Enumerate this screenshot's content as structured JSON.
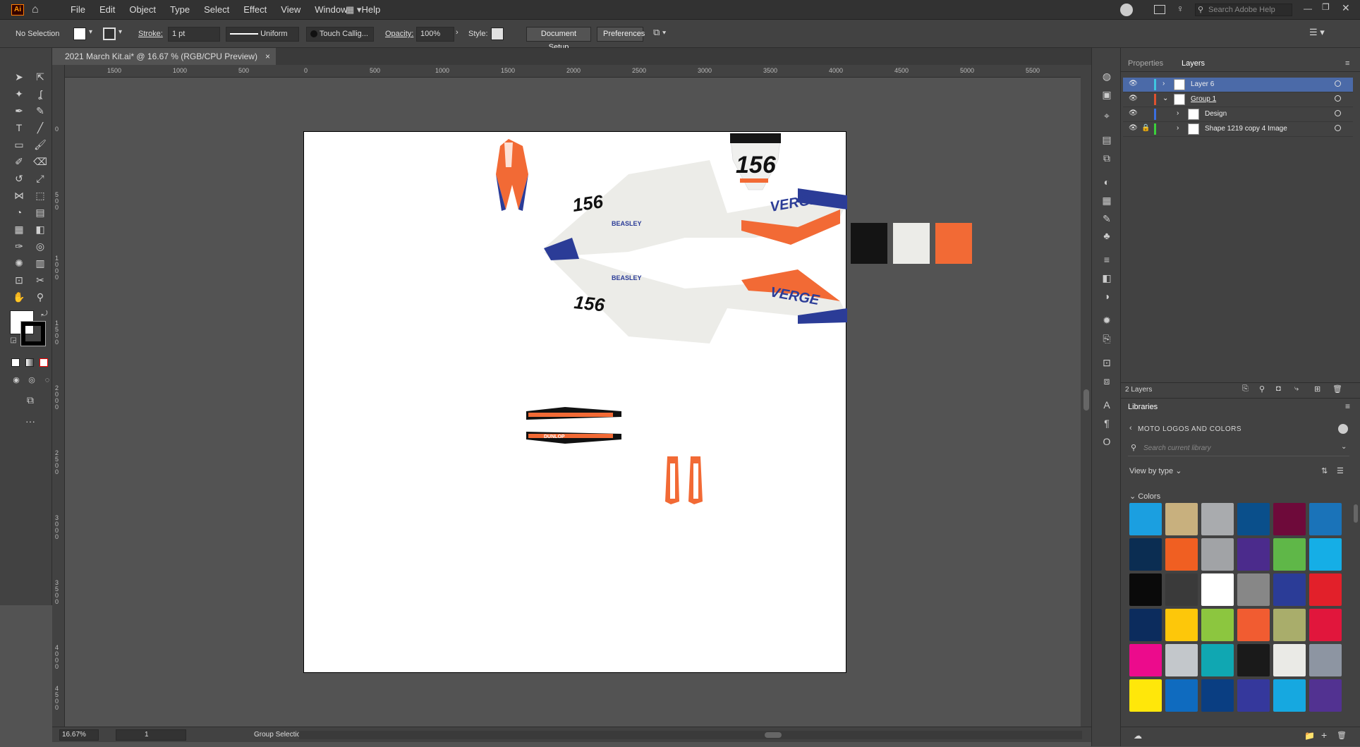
{
  "app": {
    "logo": "Ai",
    "menus": [
      "File",
      "Edit",
      "Object",
      "Type",
      "Select",
      "Effect",
      "View",
      "Window",
      "Help"
    ],
    "search_placeholder": "Search Adobe Help"
  },
  "control_bar": {
    "selection": "No Selection",
    "stroke_label": "Stroke:",
    "stroke_value": "1 pt",
    "stroke_profile": "Uniform",
    "brush": "Touch Callig...",
    "opacity_label": "Opacity:",
    "opacity_value": "100%",
    "style_label": "Style:",
    "document_setup": "Document Setup",
    "preferences": "Preferences"
  },
  "document": {
    "tab_title": "2021 March Kit.ai* @ 16.67 % (RGB/CPU Preview)",
    "close": "×"
  },
  "rulers": {
    "horizontal": [
      "1500",
      "1000",
      "500",
      "0",
      "500",
      "1000",
      "1500",
      "2000",
      "2500",
      "3000",
      "3500",
      "4000",
      "4500",
      "5000",
      "5500"
    ],
    "vertical": [
      "0",
      "500",
      "1000",
      "1500",
      "2000",
      "2500",
      "3000",
      "3500",
      "4000",
      "4500"
    ]
  },
  "artwork": {
    "race_number": "156",
    "brand": "VERGE",
    "sponsor": "DUNLOP",
    "rider": "BEASLEY",
    "swatches": [
      "#141414",
      "#ecece8",
      "#f26a35"
    ]
  },
  "status": {
    "zoom": "16.67%",
    "artboard": "1",
    "tool": "Group Selection"
  },
  "panels": {
    "tabs": [
      "Properties",
      "Layers"
    ],
    "layers": [
      {
        "name": "Layer 6",
        "selected": true,
        "color": "#3fc6e0"
      },
      {
        "name": "Group 1",
        "selected": false,
        "color": "#e0522f"
      },
      {
        "name": "Design",
        "selected": false,
        "color": "#3a6fe0"
      },
      {
        "name": "Shape 1219 copy 4 Image",
        "selected": false,
        "color": "#3bd13b"
      }
    ],
    "layers_count": "2 Layers"
  },
  "libraries": {
    "title": "Libraries",
    "library_name": "MOTO LOGOS AND COLORS",
    "search_placeholder": "Search current library",
    "view_by": "View by type",
    "section": "Colors",
    "colors": [
      "#1b9fe0",
      "#c8b07e",
      "#a9abae",
      "#0a4f8b",
      "#6e0a3a",
      "#1a73b9",
      "#0b2d52",
      "#f05f22",
      "#a1a3a6",
      "#4b2b8c",
      "#5fb748",
      "#15aee6",
      "#0a0a0a",
      "#3a3a3a",
      "#ffffff",
      "#878787",
      "#2b3c97",
      "#e2202a",
      "#0c2c5d",
      "#fdc70a",
      "#8cc63f",
      "#f15c31",
      "#a9ad6b",
      "#e1163c",
      "#ec0b8c",
      "#c3c7cb",
      "#10a7b2",
      "#1a1a1a",
      "#eaeae6",
      "#8d95a2",
      "#ffe70a",
      "#0f6bbf",
      "#0a3e82",
      "#35389c",
      "#16a8e0",
      "#523291"
    ]
  }
}
